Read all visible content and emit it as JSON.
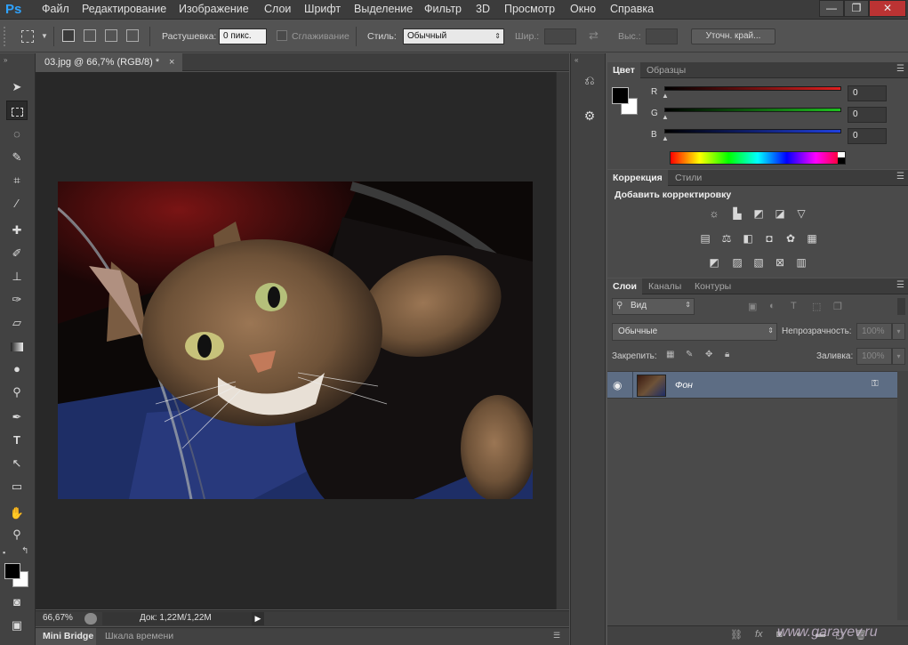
{
  "app": {
    "logo": "Ps"
  },
  "menu": [
    "Файл",
    "Редактирование",
    "Изображение",
    "Слои",
    "Шрифт",
    "Выделение",
    "Фильтр",
    "3D",
    "Просмотр",
    "Окно",
    "Справка"
  ],
  "window_buttons": {
    "minimize": "—",
    "restore": "❐",
    "close": "✕"
  },
  "options": {
    "feather_label": "Растушевка:",
    "feather_value": "0 пикс.",
    "antialias_label": "Сглаживание",
    "style_label": "Стиль:",
    "style_value": "Обычный",
    "width_label": "Шир.:",
    "height_label": "Выс.:",
    "refine_edge": "Уточн. край..."
  },
  "document": {
    "tab_title": "03.jpg @ 66,7% (RGB/8) *",
    "tab_close": "×",
    "zoom": "66,67%",
    "doc_size": "Док: 1,22M/1,22M"
  },
  "bottom_tabs": [
    "Mini Bridge",
    "Шкала времени"
  ],
  "color_panel": {
    "tabs": [
      "Цвет",
      "Образцы"
    ],
    "channels": [
      {
        "label": "R",
        "value": "0",
        "color": "#e02020"
      },
      {
        "label": "G",
        "value": "0",
        "color": "#20c020"
      },
      {
        "label": "B",
        "value": "0",
        "color": "#2040e0"
      }
    ],
    "foreground": "#000000",
    "background": "#ffffff"
  },
  "adjust_panel": {
    "tabs": [
      "Коррекция",
      "Стили"
    ],
    "title": "Добавить корректировку",
    "row1": [
      "brightness-icon",
      "levels-icon",
      "curves-icon",
      "exposure-icon",
      "triangle-icon"
    ],
    "row2": [
      "vibrance-icon",
      "balance-icon",
      "bw-icon",
      "photo-filter-icon",
      "mixer-icon",
      "lookup-icon"
    ],
    "row3": [
      "invert-icon",
      "posterize-icon",
      "threshold-icon",
      "selective-color-icon",
      "gradient-map-icon"
    ]
  },
  "layers_panel": {
    "tabs": [
      "Слои",
      "Каналы",
      "Контуры"
    ],
    "filter_kind": "Вид",
    "blend_mode": "Обычные",
    "opacity_label": "Непрозрачность:",
    "opacity_value": "100%",
    "lock_label": "Закрепить:",
    "fill_label": "Заливка:",
    "fill_value": "100%",
    "layers": [
      {
        "name": "Фон",
        "visible": true,
        "locked": true
      }
    ]
  },
  "watermark": "www.garayev.ru"
}
